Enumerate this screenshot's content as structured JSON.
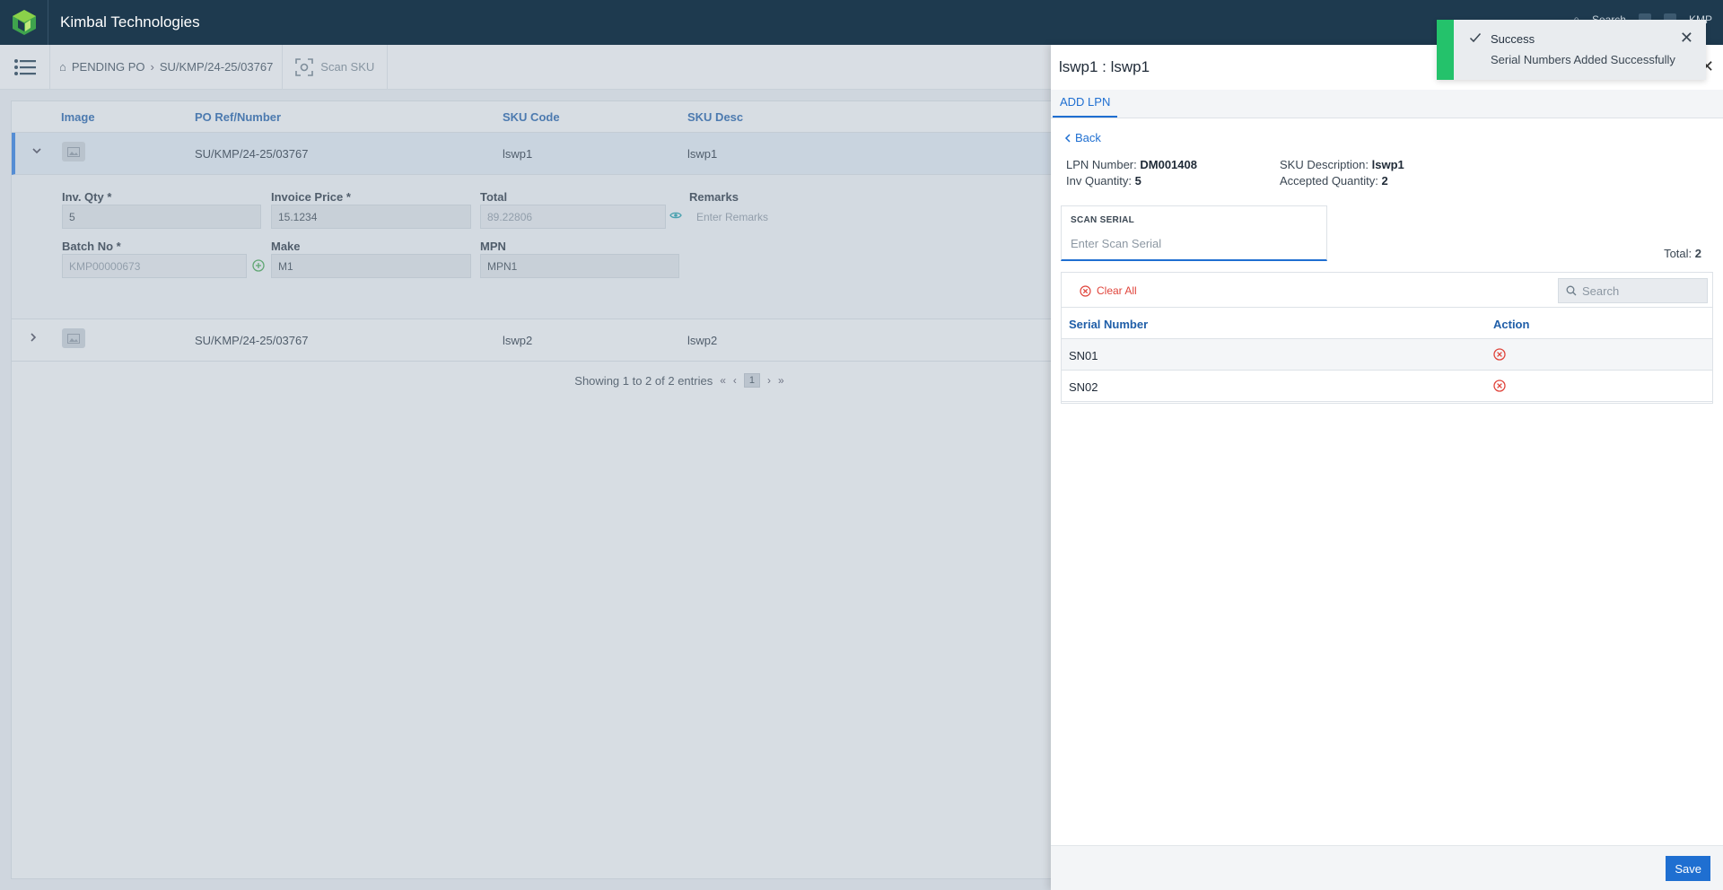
{
  "app": {
    "title": "Kimbal Technologies"
  },
  "topbar": {
    "search_label": "Search",
    "user": "KMP"
  },
  "breadcrumb": {
    "home": "PENDING PO",
    "current": "SU/KMP/24-25/03767"
  },
  "scan_sku": {
    "label": "Scan SKU"
  },
  "table": {
    "headers": [
      "Image",
      "PO Ref/Number",
      "SKU Code",
      "SKU Desc"
    ],
    "rows": [
      {
        "po": "SU/KMP/24-25/03767",
        "sku_code": "lswp1",
        "sku_desc": "lswp1"
      },
      {
        "po": "SU/KMP/24-25/03767",
        "sku_code": "lswp2",
        "sku_desc": "lswp2"
      }
    ],
    "detail": {
      "inv_qty_label": "Inv. Qty *",
      "inv_qty": "5",
      "invoice_price_label": "Invoice Price *",
      "invoice_price": "15.1234",
      "total_label": "Total",
      "total": "89.22806",
      "remarks_label": "Remarks",
      "remarks_placeholder": "Enter Remarks",
      "batch_label": "Batch No *",
      "batch": "KMP00000673",
      "make_label": "Make",
      "make": "M1",
      "mpn_label": "MPN",
      "mpn": "MPN1"
    },
    "pagination": {
      "summary": "Showing 1 to 2 of 2 entries",
      "page": "1"
    }
  },
  "panel": {
    "title": "lswp1 : lswp1",
    "tab": "ADD LPN",
    "back": "Back",
    "lpn_label": "LPN Number:",
    "lpn": "DM001408",
    "sku_desc_label": "SKU Description:",
    "sku_desc": "lswp1",
    "inv_qty_label": "Inv Quantity:",
    "inv_qty": "5",
    "accepted_label": "Accepted Quantity:",
    "accepted": "2",
    "scan_label": "SCAN SERIAL",
    "scan_placeholder": "Enter Scan Serial",
    "total_label": "Total:",
    "total": "2",
    "clear_all": "Clear All",
    "search_placeholder": "Search",
    "serial_headers": [
      "Serial Number",
      "Action"
    ],
    "serials": [
      "SN01",
      "SN02"
    ],
    "save": "Save"
  },
  "toast": {
    "title": "Success",
    "message": "Serial Numbers Added Successfully",
    "color": "#24c26b"
  }
}
